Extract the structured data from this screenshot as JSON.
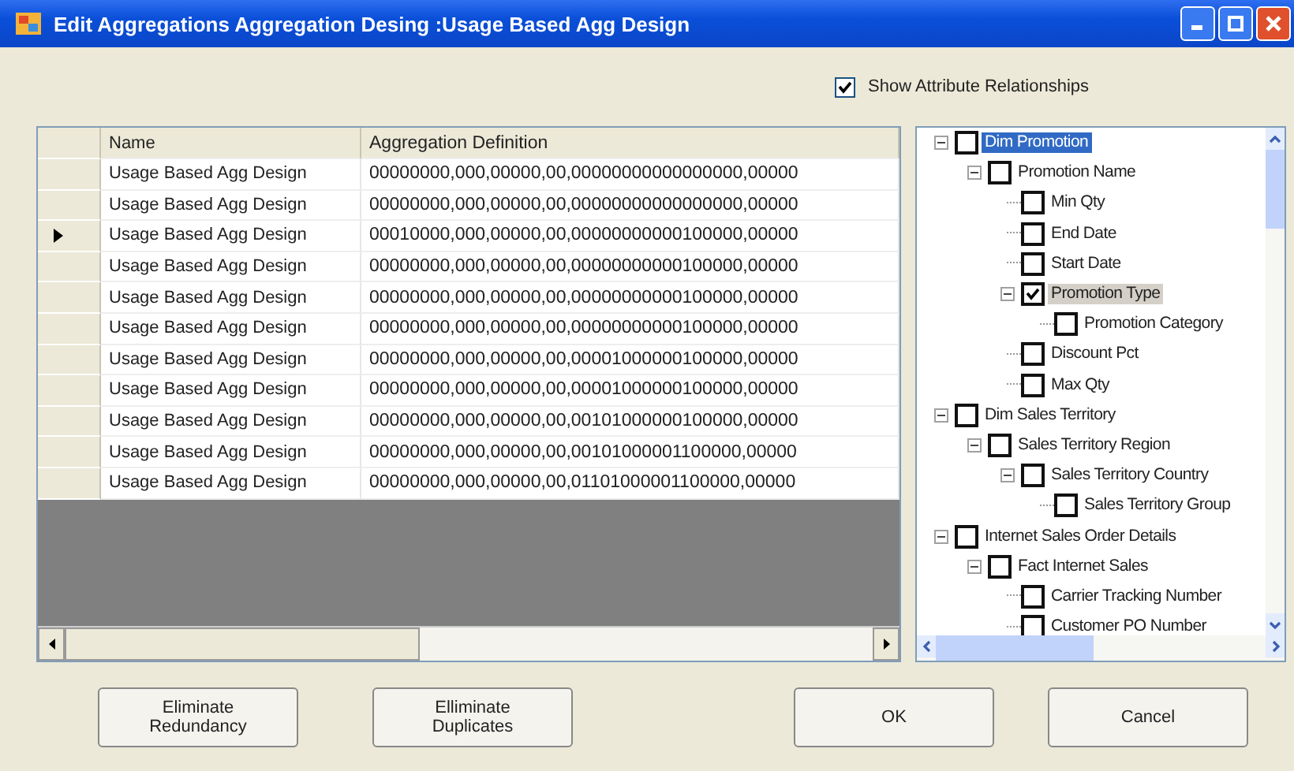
{
  "window": {
    "title": "Edit Aggregations Aggregation Desing :Usage Based Agg Design"
  },
  "show_attribute_relationships": {
    "label": "Show Attribute Relationships",
    "checked": true
  },
  "grid": {
    "columns": [
      "Name",
      "Aggregation Definition"
    ],
    "rows": [
      {
        "name": "Usage Based Agg Design",
        "definition": "00000000,000,00000,00,00000000000000000,00000",
        "selected": false
      },
      {
        "name": "Usage Based Agg Design",
        "definition": "00000000,000,00000,00,00000000000000000,00000",
        "selected": false
      },
      {
        "name": "Usage Based Agg Design",
        "definition": "00010000,000,00000,00,00000000000100000,00000",
        "selected": true
      },
      {
        "name": "Usage Based Agg Design",
        "definition": "00000000,000,00000,00,00000000000100000,00000",
        "selected": false
      },
      {
        "name": "Usage Based Agg Design",
        "definition": "00000000,000,00000,00,00000000000100000,00000",
        "selected": false
      },
      {
        "name": "Usage Based Agg Design",
        "definition": "00000000,000,00000,00,00000000000100000,00000",
        "selected": false
      },
      {
        "name": "Usage Based Agg Design",
        "definition": "00000000,000,00000,00,00001000000100000,00000",
        "selected": false
      },
      {
        "name": "Usage Based Agg Design",
        "definition": "00000000,000,00000,00,00001000000100000,00000",
        "selected": false
      },
      {
        "name": "Usage Based Agg Design",
        "definition": "00000000,000,00000,00,00101000000100000,00000",
        "selected": false
      },
      {
        "name": "Usage Based Agg Design",
        "definition": "00000000,000,00000,00,00101000001100000,00000",
        "selected": false
      },
      {
        "name": "Usage Based Agg Design",
        "definition": "00000000,000,00000,00,01101000001100000,00000",
        "selected": false
      }
    ]
  },
  "tree": {
    "items": [
      {
        "label": "Dim Promotion",
        "checked": false,
        "selected": true,
        "highlighted": false,
        "expanded": true,
        "children": [
          {
            "label": "Promotion Name",
            "checked": false,
            "selected": false,
            "highlighted": false,
            "expanded": true,
            "children": [
              {
                "label": "Min Qty",
                "checked": false,
                "selected": false,
                "highlighted": false
              },
              {
                "label": "End Date",
                "checked": false,
                "selected": false,
                "highlighted": false
              },
              {
                "label": "Start Date",
                "checked": false,
                "selected": false,
                "highlighted": false
              },
              {
                "label": "Promotion Type",
                "checked": true,
                "selected": false,
                "highlighted": true,
                "expanded": true,
                "children": [
                  {
                    "label": "Promotion Category",
                    "checked": false,
                    "selected": false,
                    "highlighted": false
                  }
                ]
              },
              {
                "label": "Discount Pct",
                "checked": false,
                "selected": false,
                "highlighted": false
              },
              {
                "label": "Max Qty",
                "checked": false,
                "selected": false,
                "highlighted": false
              }
            ]
          }
        ]
      },
      {
        "label": "Dim Sales Territory",
        "checked": false,
        "selected": false,
        "highlighted": false,
        "expanded": true,
        "children": [
          {
            "label": "Sales Territory Region",
            "checked": false,
            "selected": false,
            "highlighted": false,
            "expanded": true,
            "children": [
              {
                "label": "Sales Territory Country",
                "checked": false,
                "selected": false,
                "highlighted": false,
                "expanded": true,
                "children": [
                  {
                    "label": "Sales Territory Group",
                    "checked": false,
                    "selected": false,
                    "highlighted": false
                  }
                ]
              }
            ]
          }
        ]
      },
      {
        "label": "Internet Sales Order Details",
        "checked": false,
        "selected": false,
        "highlighted": false,
        "expanded": true,
        "children": [
          {
            "label": "Fact Internet Sales",
            "checked": false,
            "selected": false,
            "highlighted": false,
            "expanded": true,
            "children": [
              {
                "label": "Carrier Tracking Number",
                "checked": false,
                "selected": false,
                "highlighted": false
              },
              {
                "label": "Customer PO Number",
                "checked": false,
                "selected": false,
                "highlighted": false
              }
            ]
          }
        ]
      }
    ]
  },
  "buttons": [
    "Eliminate Redundancy",
    "Elliminate Duplicates",
    "OK",
    "Cancel"
  ]
}
